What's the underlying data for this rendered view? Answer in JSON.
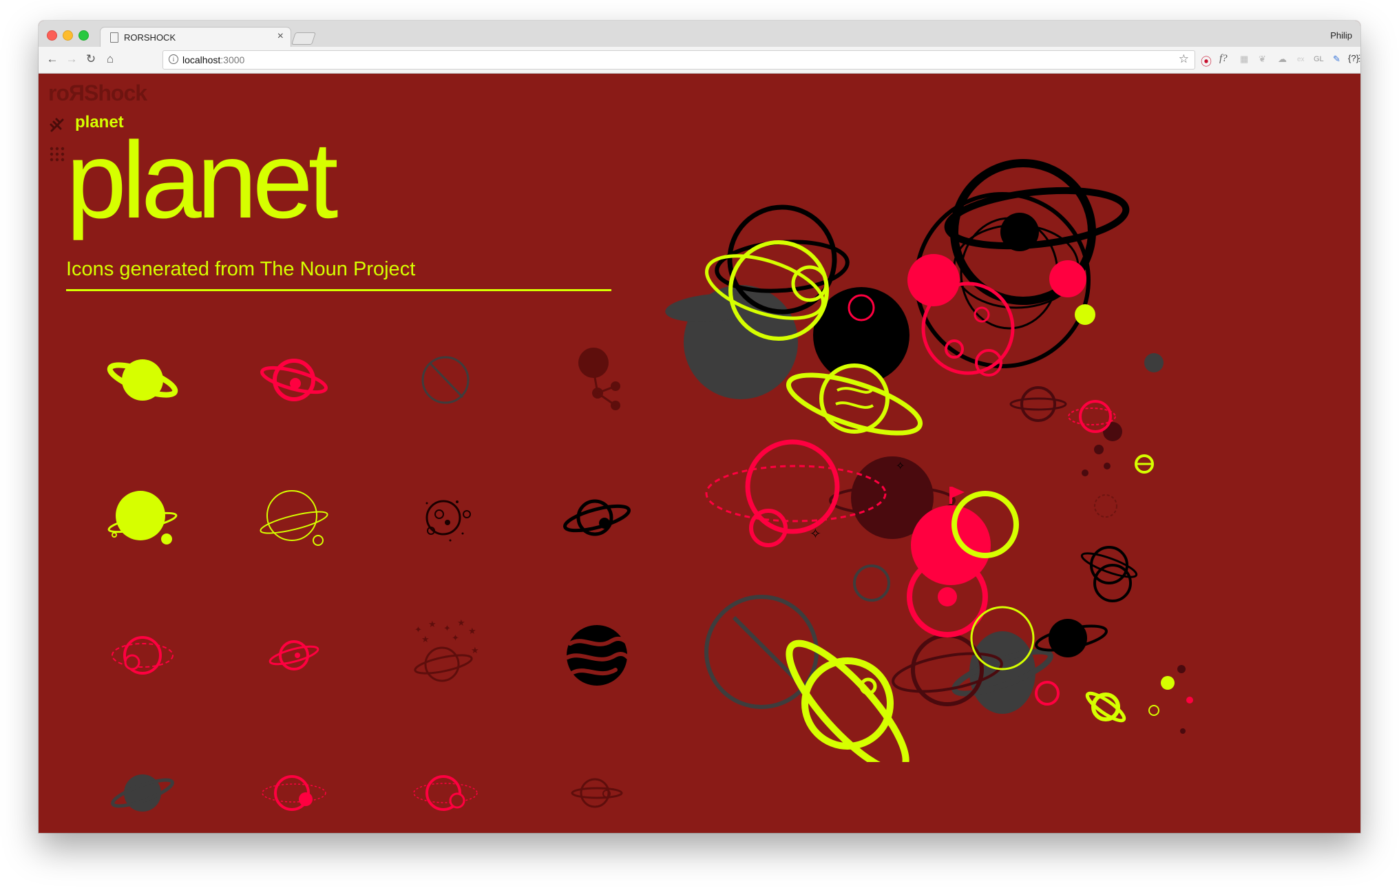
{
  "browser": {
    "tab_title": "RORSHOCK",
    "profile_name": "Philip",
    "url_host": "localhost",
    "url_port": ":3000",
    "extensions": [
      "pinterest-icon",
      "f?",
      "grid-icon",
      "leaf-icon",
      "cloud-icon",
      "ex",
      "GL",
      "color-picker-icon",
      "{?}"
    ]
  },
  "app": {
    "logo": "roЯShock",
    "breadcrumb": "planet",
    "title": "planet",
    "subtitle": "Icons generated from The Noun Project"
  },
  "colors": {
    "background": "#8a1b17",
    "lime": "#d6ff00",
    "pink": "#ff0040",
    "charcoal": "#3d3d3d",
    "black": "#000000",
    "maroon": "#5e0e0c"
  },
  "icons": [
    {
      "name": "planet-ring-icon",
      "color": "lime",
      "style": "filled"
    },
    {
      "name": "planet-orbit-icon",
      "color": "pink",
      "style": "outline"
    },
    {
      "name": "planet-slash-icon",
      "color": "charcoal",
      "style": "outline"
    },
    {
      "name": "planet-molecule-icon",
      "color": "maroon",
      "style": "filled"
    },
    {
      "name": "planet-moon-icon",
      "color": "lime",
      "style": "filled"
    },
    {
      "name": "planet-thin-ring-icon",
      "color": "lime",
      "style": "outline"
    },
    {
      "name": "planet-craters-icon",
      "color": "black",
      "style": "outline"
    },
    {
      "name": "planet-satellite-icon",
      "color": "black",
      "style": "outline"
    },
    {
      "name": "planet-dashed-orbit-icon",
      "color": "pink",
      "style": "outline"
    },
    {
      "name": "planet-small-orbit-icon",
      "color": "pink",
      "style": "outline"
    },
    {
      "name": "planet-stars-icon",
      "color": "maroon",
      "style": "outline"
    },
    {
      "name": "planet-striped-icon",
      "color": "black",
      "style": "filled"
    },
    {
      "name": "planet-saturn-icon",
      "color": "charcoal",
      "style": "filled"
    },
    {
      "name": "planet-moon-orbit-icon",
      "color": "pink",
      "style": "outline"
    },
    {
      "name": "planet-double-icon",
      "color": "pink",
      "style": "outline"
    },
    {
      "name": "planet-minimal-icon",
      "color": "maroon",
      "style": "outline"
    }
  ]
}
